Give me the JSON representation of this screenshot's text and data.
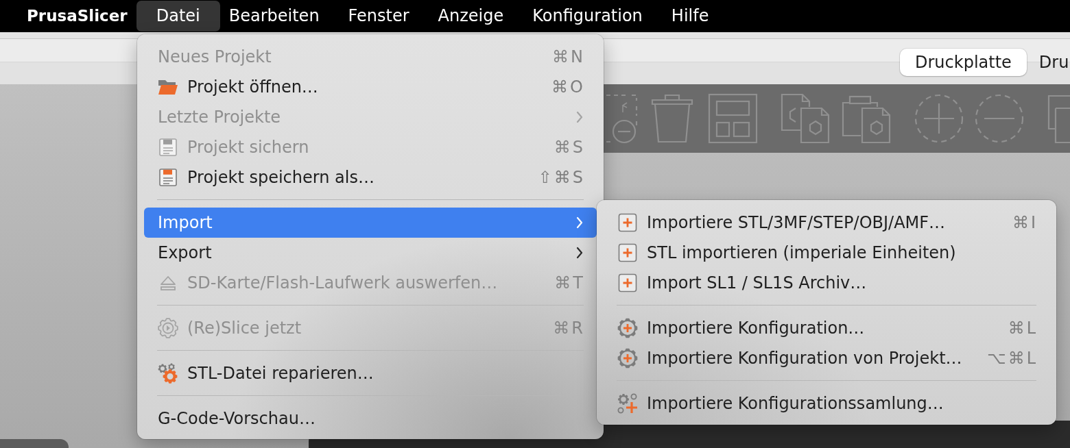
{
  "menubar": {
    "app_name": "PrusaSlicer",
    "menus": [
      {
        "label": "Datei",
        "selected": true
      },
      {
        "label": "Bearbeiten",
        "selected": false
      },
      {
        "label": "Fenster",
        "selected": false
      },
      {
        "label": "Anzeige",
        "selected": false
      },
      {
        "label": "Konfiguration",
        "selected": false
      },
      {
        "label": "Hilfe",
        "selected": false
      }
    ]
  },
  "tabs": [
    {
      "label": "Druckplatte",
      "selected": true
    },
    {
      "label": "Dru",
      "selected": false
    }
  ],
  "file_menu": {
    "items": [
      {
        "kind": "item",
        "label": "Neues Projekt",
        "shortcut": "⌘N",
        "disabled": true,
        "selected": false
      },
      {
        "kind": "item",
        "label": "Projekt öffnen…",
        "shortcut": "⌘O",
        "disabled": false,
        "selected": false
      },
      {
        "kind": "submenu",
        "label": "Letzte Projekte",
        "disabled": true,
        "selected": false
      },
      {
        "kind": "item",
        "label": "Projekt sichern",
        "shortcut": "⌘S",
        "disabled": true,
        "selected": false
      },
      {
        "kind": "item",
        "label": "Projekt speichern als…",
        "shortcut": "⇧⌘S",
        "disabled": false,
        "selected": false
      },
      {
        "kind": "separator"
      },
      {
        "kind": "submenu",
        "label": "Import",
        "disabled": false,
        "selected": true
      },
      {
        "kind": "submenu",
        "label": "Export",
        "disabled": false,
        "selected": false
      },
      {
        "kind": "item",
        "label": "SD-Karte/Flash-Laufwerk auswerfen…",
        "shortcut": "⌘T",
        "disabled": true,
        "selected": false
      },
      {
        "kind": "separator"
      },
      {
        "kind": "item",
        "label": "(Re)Slice jetzt",
        "shortcut": "⌘R",
        "disabled": true,
        "selected": false
      },
      {
        "kind": "separator"
      },
      {
        "kind": "item",
        "label": "STL-Datei reparieren…",
        "disabled": false,
        "selected": false
      },
      {
        "kind": "separator"
      },
      {
        "kind": "item",
        "label": "G-Code-Vorschau…",
        "disabled": false,
        "selected": false
      }
    ]
  },
  "import_submenu": {
    "items": [
      {
        "kind": "item",
        "label": "Importiere STL/3MF/STEP/OBJ/AMF…",
        "shortcut": "⌘I",
        "disabled": false,
        "selected": false
      },
      {
        "kind": "item",
        "label": "STL importieren (imperiale Einheiten)",
        "disabled": false,
        "selected": false
      },
      {
        "kind": "item",
        "label": "Import SL1 / SL1S Archiv…",
        "disabled": false,
        "selected": false
      },
      {
        "kind": "separator"
      },
      {
        "kind": "item",
        "label": "Importiere Konfiguration…",
        "shortcut": "⌘L",
        "disabled": false,
        "selected": false
      },
      {
        "kind": "item",
        "label": "Importiere Konfiguration von Projekt…",
        "shortcut": "⌥⌘L",
        "disabled": false,
        "selected": false
      },
      {
        "kind": "separator"
      },
      {
        "kind": "item",
        "label": "Importiere Konfigurationssamlung…",
        "disabled": false,
        "selected": false
      }
    ]
  }
}
